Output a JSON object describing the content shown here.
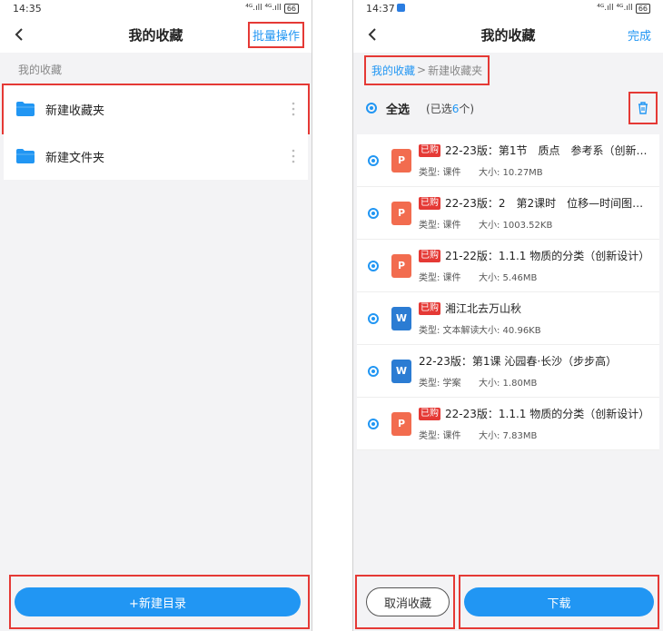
{
  "left": {
    "status": {
      "time": "14:35",
      "battery": "66",
      "signal": "⁴ᴳ.ıll ⁴ᴳ.ıll"
    },
    "header": {
      "title": "我的收藏",
      "action": "批量操作"
    },
    "section_label": "我的收藏",
    "folders": [
      {
        "label": "新建收藏夹"
      },
      {
        "label": "新建文件夹"
      }
    ],
    "bottom_button": "+新建目录"
  },
  "right": {
    "status": {
      "time": "14:37",
      "battery": "66",
      "signal": "⁴ᴳ.ıll ⁴ᴳ.ıll"
    },
    "header": {
      "title": "我的收藏",
      "action": "完成"
    },
    "breadcrumb": {
      "root": "我的收藏",
      "separator": ">",
      "current": "新建收藏夹"
    },
    "select_all": {
      "label": "全选",
      "count_prefix": "(已选",
      "count": "6",
      "count_suffix": "个)"
    },
    "files": [
      {
        "badge": "已购",
        "icon": "P",
        "kind": "ppt",
        "title": "22-23版：第1节　质点　参考系（创新设…",
        "type": "类型: 课件",
        "size": "大小: 10.27MB"
      },
      {
        "badge": "已购",
        "icon": "P",
        "kind": "ppt",
        "title": "22-23版：2　第2课时　位移—时间图像　…",
        "type": "类型: 课件",
        "size": "大小: 1003.52KB"
      },
      {
        "badge": "已购",
        "icon": "P",
        "kind": "ppt",
        "title": "21-22版：1.1.1 物质的分类（创新设计）",
        "type": "类型: 课件",
        "size": "大小: 5.46MB"
      },
      {
        "badge": "已购",
        "icon": "W",
        "kind": "doc",
        "title": "湘江北去万山秋",
        "type": "类型: 文本解读",
        "size": "大小: 40.96KB"
      },
      {
        "badge": "",
        "icon": "W",
        "kind": "doc",
        "title": "22-23版：第1课 沁园春·长沙（步步高）",
        "type": "类型: 学案",
        "size": "大小: 1.80MB"
      },
      {
        "badge": "已购",
        "icon": "P",
        "kind": "ppt",
        "title": "22-23版：1.1.1 物质的分类（创新设计）",
        "type": "类型: 课件",
        "size": "大小: 7.83MB"
      }
    ],
    "cancel_button": "取消收藏",
    "download_button": "下载"
  }
}
